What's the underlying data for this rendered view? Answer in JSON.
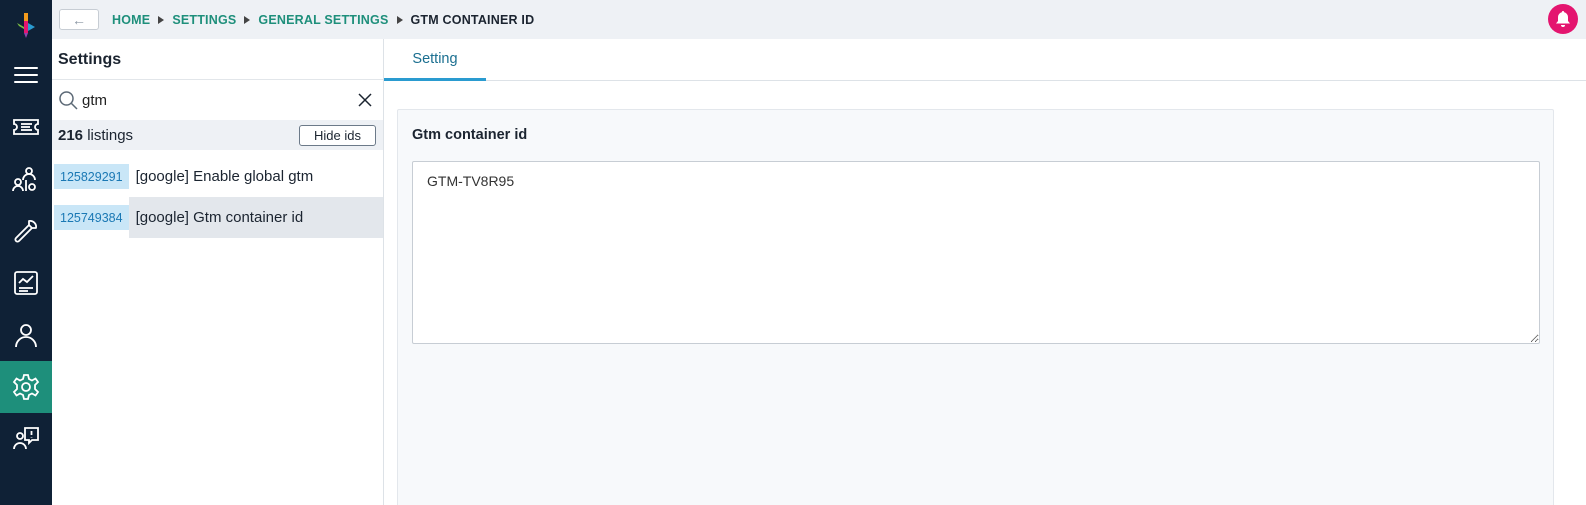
{
  "rail": {
    "items": [
      {
        "name": "menu"
      },
      {
        "name": "tickets"
      },
      {
        "name": "people-hierarchy"
      },
      {
        "name": "tools"
      },
      {
        "name": "reports"
      },
      {
        "name": "user"
      },
      {
        "name": "settings",
        "active": true
      },
      {
        "name": "feedback"
      }
    ]
  },
  "topbar": {
    "back_label": "←",
    "breadcrumb": [
      "HOME",
      "SETTINGS",
      "GENERAL SETTINGS",
      "GTM CONTAINER ID"
    ]
  },
  "panel": {
    "title": "Settings",
    "search": {
      "value": "gtm"
    },
    "listing_count": "216",
    "listing_word": "listings",
    "hide_ids_label": "Hide ids",
    "rows": [
      {
        "id": "125829291",
        "label": "[google] Enable global gtm",
        "selected": false
      },
      {
        "id": "125749384",
        "label": "[google] Gtm container id",
        "selected": true
      }
    ]
  },
  "tabs": [
    {
      "label": "Setting",
      "active": true
    }
  ],
  "field": {
    "label": "Gtm container id",
    "value": "GTM-TV8R95"
  },
  "colors": {
    "rail_bg": "#0f2136",
    "accent": "#1e8f7b",
    "bell": "#e4156f",
    "id_badge_bg": "#c9e6f7",
    "tab_underline": "#2a9bd0"
  }
}
